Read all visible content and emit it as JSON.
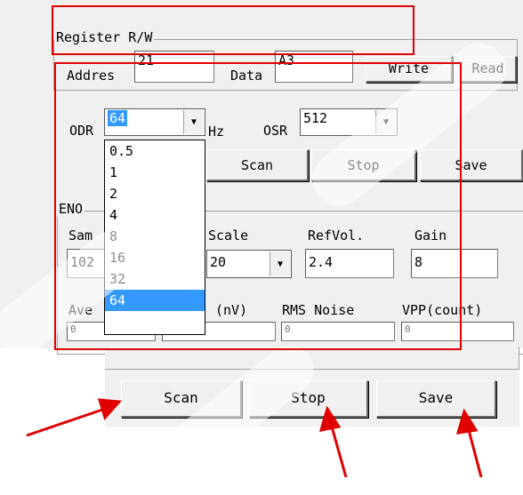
{
  "register_group": {
    "legend": "Register R/W",
    "address_label": "Addres",
    "address_value": "21",
    "data_label": "Data",
    "data_value": "A3",
    "write_label": "Write",
    "read_label": "Read"
  },
  "rate": {
    "odr_label": "ODR",
    "odr_value": "64",
    "odr_unit": "Hz",
    "osr_label": "OSR",
    "osr_value": "512"
  },
  "odr_dropdown": {
    "options": [
      "0.5",
      "1",
      "2",
      "4",
      "8",
      "16",
      "32",
      "64"
    ],
    "selected": "64"
  },
  "actions_top": {
    "scan_label": "Scan",
    "stop_label": "Stop",
    "save_label": "Save"
  },
  "eno_group": {
    "legend": "ENO",
    "samples_label": "Sam",
    "samples_value": "102",
    "scale_label": "Scale",
    "scale_value": "20",
    "refvol_label": "RefVol.",
    "refvol_value": "2.4",
    "gain_label": "Gain",
    "gain_value": "8",
    "ave_label": "Ave",
    "nv_label": "(nV)",
    "rms_label": "RMS Noise",
    "vpp_label": "VPP(count)",
    "ave_value": "0",
    "nv_value": "0",
    "rms_value": "0",
    "vpp_value": "0"
  },
  "actions_bottom": {
    "scan_label": "Scan",
    "stop_label": "Stop",
    "save_label": "Save"
  },
  "colors": {
    "annotation": "#e00000",
    "selection": "#3399ff",
    "panel": "#f0f0f0"
  }
}
